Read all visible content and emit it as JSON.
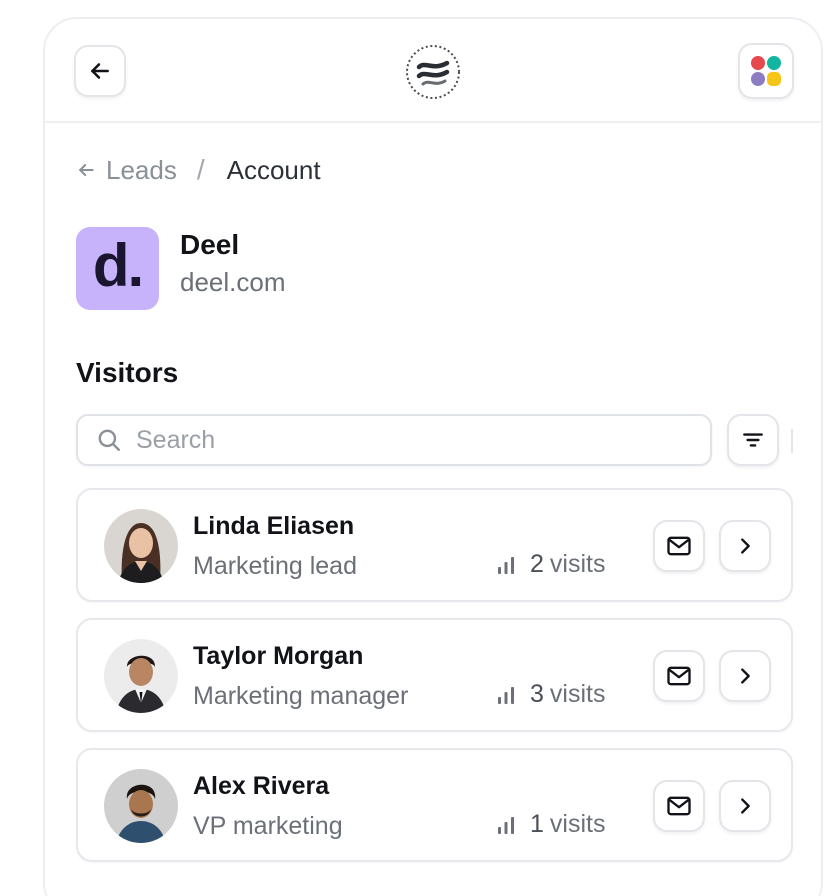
{
  "breadcrumb": {
    "parent": "Leads",
    "separator": "/",
    "current": "Account"
  },
  "company": {
    "logo_letter": "d.",
    "name": "Deel",
    "domain": "deel.com",
    "logo_color": "#c7b3fb"
  },
  "visitors": {
    "title": "Visitors",
    "search_placeholder": "Search",
    "list": [
      {
        "name": "Linda Eliasen",
        "role": "Marketing lead",
        "visits_count": "2",
        "visits_label": "visits"
      },
      {
        "name": "Taylor Morgan",
        "role": "Marketing manager",
        "visits_count": "3",
        "visits_label": "visits"
      },
      {
        "name": "Alex Rivera",
        "role": "VP marketing",
        "visits_count": "1",
        "visits_label": "visits"
      }
    ]
  },
  "icons": {
    "back": "arrow-left-icon",
    "logo": "brand-logo-icon",
    "apps": "apps-grid-icon",
    "search": "search-icon",
    "filter": "filter-icon",
    "visits": "bar-chart-icon",
    "mail": "mail-icon",
    "chevron": "chevron-right-icon"
  },
  "colors": {
    "app_red": "#e5484d",
    "app_teal": "#12b5a0",
    "app_purple": "#8e7cc3",
    "app_yellow": "#f5c518"
  }
}
